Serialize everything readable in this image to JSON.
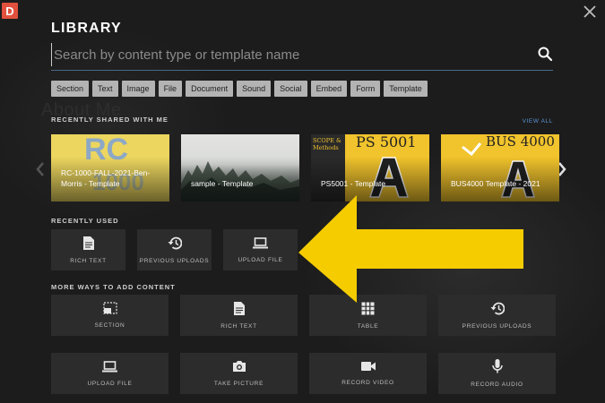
{
  "app": {
    "logo_letter": "D",
    "bg_text": "About Me"
  },
  "header": {
    "title": "LIBRARY"
  },
  "search": {
    "placeholder": "Search by content type or template name"
  },
  "filters": [
    "Section",
    "Text",
    "Image",
    "File",
    "Document",
    "Sound",
    "Social",
    "Embed",
    "Form",
    "Template"
  ],
  "recently_shared": {
    "label": "RECENTLY SHARED WITH ME",
    "view_all": "VIEW ALL",
    "items": [
      {
        "label": "RC-1000-FALL-2021-Ben-Morris - Template",
        "thumb_big": "RC",
        "thumb_big2": "1000"
      },
      {
        "label": "sample - Template"
      },
      {
        "label": "PS5001 - Template",
        "thumb_code": "PS 5001",
        "thumb_side": "SCOPE & Methods"
      },
      {
        "label": "BUS4000 Template - 2021",
        "thumb_code": "BUS 4000"
      }
    ]
  },
  "recently_used": {
    "label": "RECENTLY USED",
    "items": [
      {
        "label": "RICH TEXT",
        "icon": "document-icon"
      },
      {
        "label": "PREVIOUS UPLOADS",
        "icon": "history-icon"
      },
      {
        "label": "UPLOAD FILE",
        "icon": "laptop-icon"
      }
    ]
  },
  "more_ways": {
    "label": "MORE WAYS TO ADD CONTENT",
    "items": [
      {
        "label": "SECTION",
        "icon": "section-icon"
      },
      {
        "label": "RICH TEXT",
        "icon": "document-icon"
      },
      {
        "label": "TABLE",
        "icon": "table-icon"
      },
      {
        "label": "PREVIOUS UPLOADS",
        "icon": "history-icon"
      },
      {
        "label": "UPLOAD FILE",
        "icon": "laptop-icon"
      },
      {
        "label": "TAKE PICTURE",
        "icon": "camera-icon"
      },
      {
        "label": "RECORD VIDEO",
        "icon": "video-camera-icon"
      },
      {
        "label": "RECORD AUDIO",
        "icon": "microphone-icon"
      }
    ]
  },
  "colors": {
    "accent_arrow": "#f5cc00",
    "link": "#5b95d6",
    "logo": "#e2513d"
  }
}
